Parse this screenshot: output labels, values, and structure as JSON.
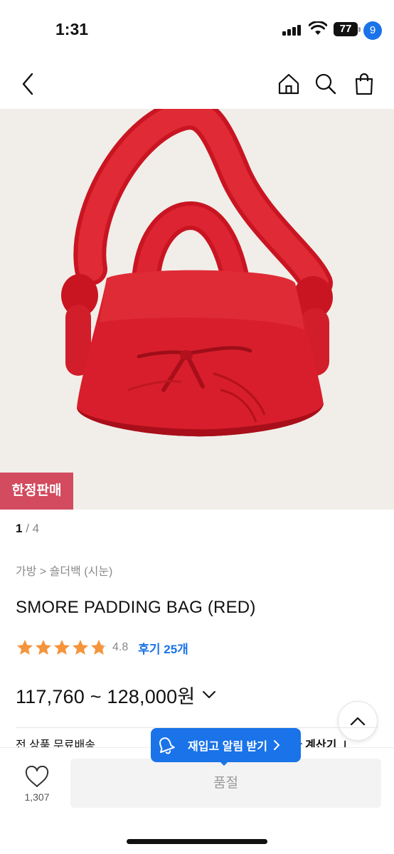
{
  "status": {
    "time": "1:31",
    "battery": "77"
  },
  "nav": {
    "back_icon": "chevron-left-icon",
    "home_icon": "home-icon",
    "search_icon": "search-icon",
    "cart_icon": "shopping-bag-icon",
    "cart_count": "9"
  },
  "hero": {
    "badge": "한정판매",
    "bag_color": "#d81e2c",
    "background": "#f1eee9"
  },
  "pager": {
    "current": "1",
    "total": "/ 4"
  },
  "product": {
    "breadcrumb": "가방 > 숄더백 (시눈)",
    "name": "SMORE PADDING BAG (RED)",
    "rating": 4.8,
    "rating_label": "4.8",
    "review_label": "후기 25개",
    "price": "117,760 ~ 128,000원"
  },
  "shipping": {
    "left": "전 상품 무료배송",
    "right": "가 계산기 ⊥"
  },
  "restock": {
    "label": "재입고 알림 받기"
  },
  "bottom": {
    "wish_count": "1,307",
    "soldout_label": "품절"
  },
  "colors": {
    "accent": "#1a73e8",
    "badge": "#d24b5e",
    "star": "#f5943b"
  }
}
